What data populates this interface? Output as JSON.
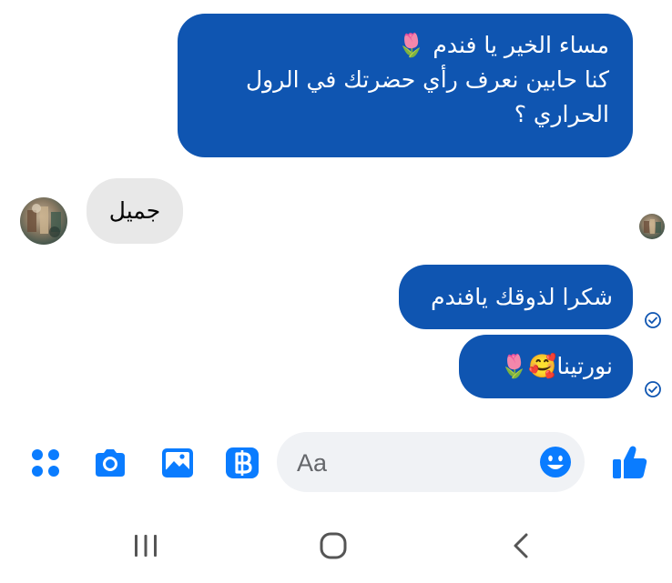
{
  "conversation": {
    "messages": [
      {
        "direction": "outgoing",
        "lines": [
          "مساء الخير يا فندم 🌷",
          "كنا حابين نعرف رأي حضرتك في الرول",
          "الحراري ؟"
        ]
      },
      {
        "direction": "incoming",
        "text": "جميل"
      },
      {
        "direction": "outgoing",
        "text": "شكرا لذوقك يافندم"
      },
      {
        "direction": "outgoing",
        "text": "نورتينا🥰🌷"
      }
    ]
  },
  "composer": {
    "placeholder": "Aa",
    "icons": [
      "apps-grid-icon",
      "camera-icon",
      "gallery-icon",
      "baht-currency-icon",
      "emoji-icon",
      "thumbs-up-icon"
    ]
  },
  "navigation": {
    "icons": [
      "recent-apps-icon",
      "home-icon",
      "back-icon"
    ]
  },
  "colors": {
    "accent": "#0f55b1",
    "toolbar_icon": "#0a7cff",
    "incoming_bubble": "#e8e8e8",
    "input_bg": "#f0f2f5",
    "nav_icon": "#555555"
  }
}
